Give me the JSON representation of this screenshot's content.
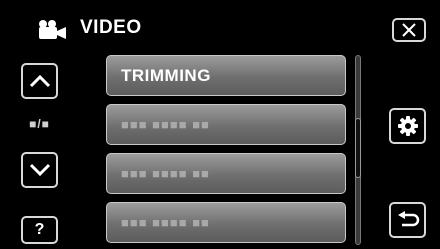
{
  "header": {
    "title": "VIDEO",
    "icon": "video-camera-icon"
  },
  "menu": {
    "items": [
      {
        "label": "TRIMMING"
      },
      {
        "label": "■■■ ■■■■ ■■"
      },
      {
        "label": "■■■ ■■■■ ■■"
      },
      {
        "label": "■■■ ■■■■ ■■"
      }
    ]
  },
  "nav": {
    "page_indicator": "■/■",
    "help_label": "?"
  },
  "icons": {
    "close": "close-icon",
    "up": "chevron-up-icon",
    "down": "chevron-down-icon",
    "settings": "gear-icon",
    "back": "return-icon"
  },
  "colors": {
    "background": "#000000",
    "item_bg": "#7a7a7a",
    "border": "#d8d8d8"
  }
}
